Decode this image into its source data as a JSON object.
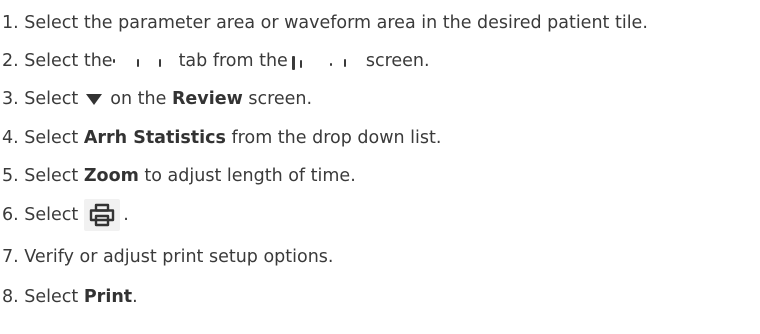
{
  "steps": [
    {
      "num": "1.",
      "text": "Select the parameter area or waveform area in the desired patient tile."
    },
    {
      "num": "2.",
      "before": "Select the",
      "middle": "tab from the",
      "after": "screen."
    },
    {
      "num": "3.",
      "before": "Select",
      "middle": "on the",
      "bold": "Review",
      "after": "screen.",
      "icon": "dropdown-triangle-icon"
    },
    {
      "num": "4.",
      "before": "Select",
      "bold": "Arrh Statistics",
      "after": "from the drop down list."
    },
    {
      "num": "5.",
      "before": "Select",
      "bold": "Zoom",
      "after": "to adjust length of time."
    },
    {
      "num": "6.",
      "before": "Select",
      "after": ".",
      "icon": "printer-icon"
    },
    {
      "num": "7.",
      "text": "Verify or adjust print setup options."
    },
    {
      "num": "8.",
      "before": "Select",
      "bold": "Print",
      "after": "."
    }
  ],
  "colors": {
    "text": "#3a3a3a",
    "icon_background": "#f1f1f1"
  }
}
